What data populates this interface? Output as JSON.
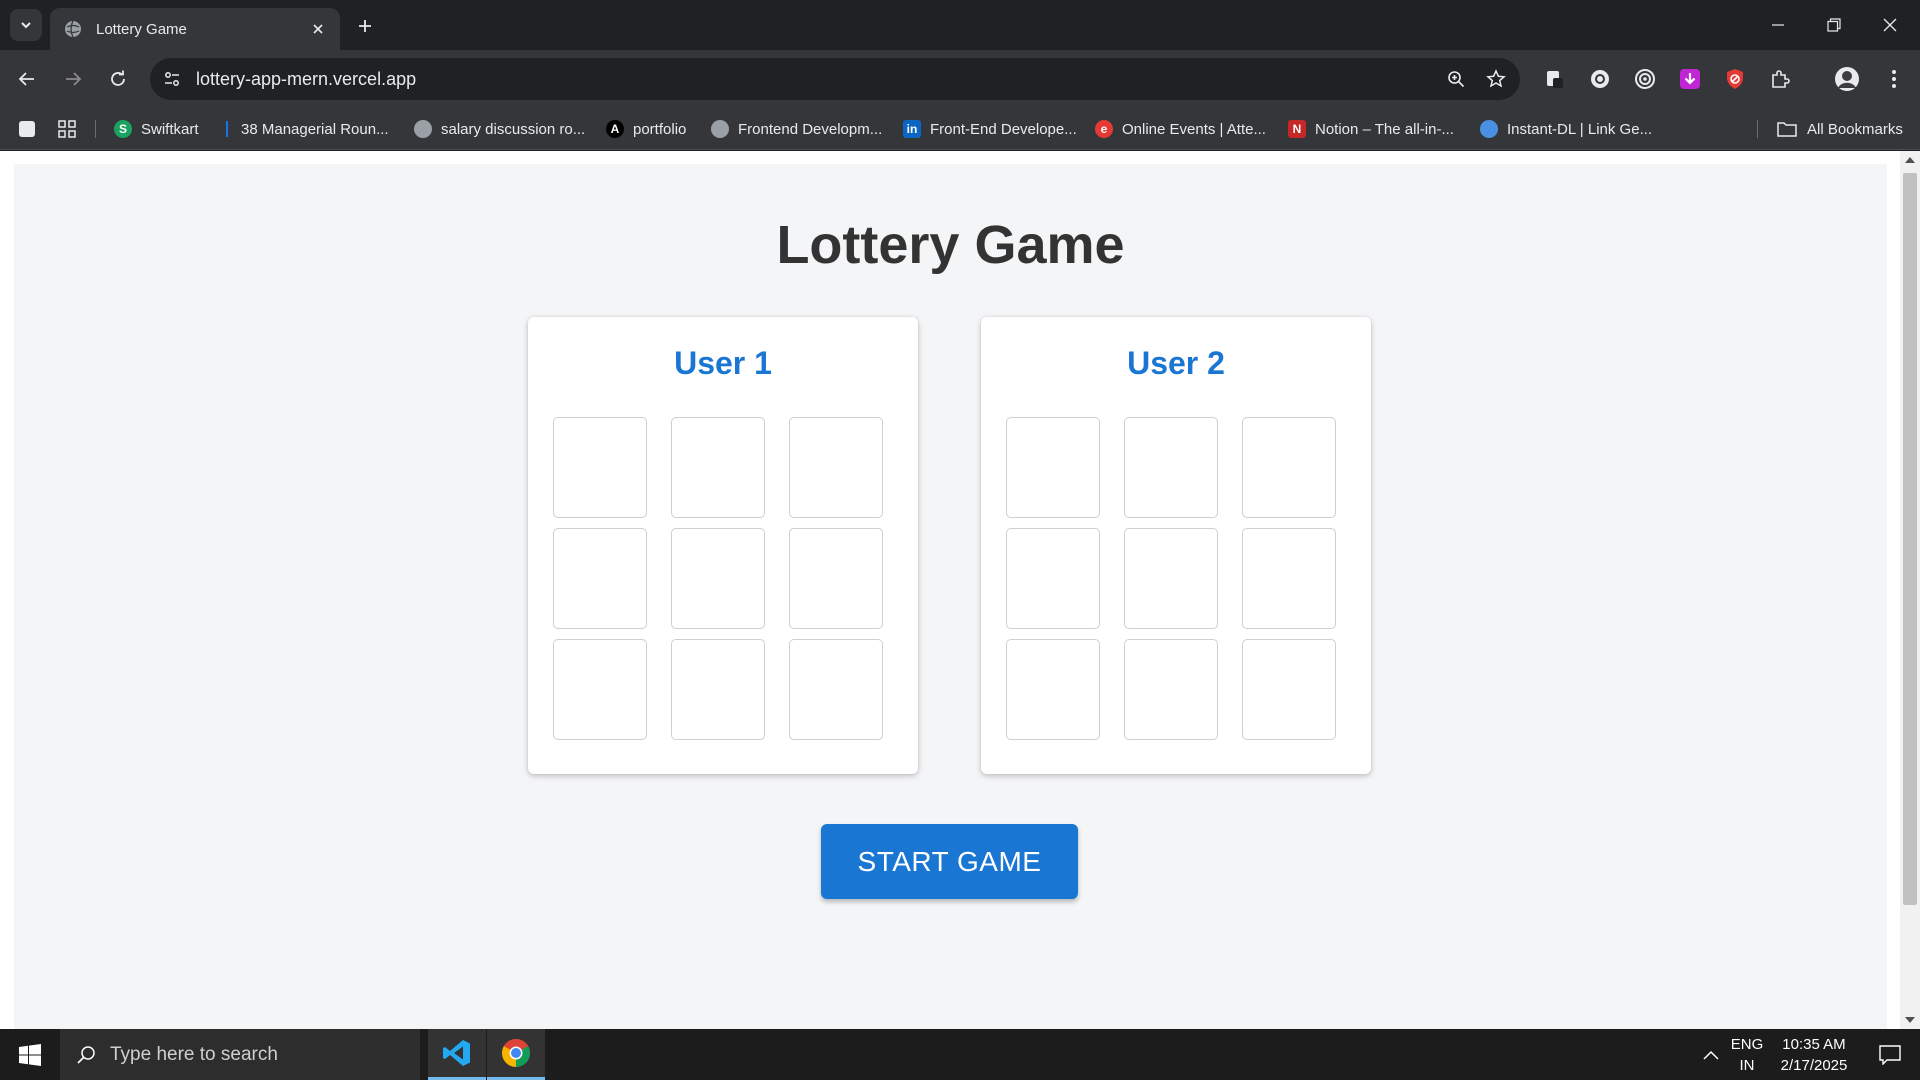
{
  "browser": {
    "tab": {
      "title": "Lottery Game"
    },
    "address": {
      "url": "lottery-app-mern.vercel.app"
    },
    "bookmarks": [
      {
        "label": "Swiftkart",
        "icon": "swiftkart-icon",
        "color": "#1aa260"
      },
      {
        "label": "38 Managerial Roun...",
        "icon": "bookmark-icon",
        "color": "#1a73e8"
      },
      {
        "label": "salary discussion ro...",
        "icon": "globe-icon",
        "color": "#9aa0a6"
      },
      {
        "label": "portfolio",
        "icon": "portfolio-icon",
        "color": "#000000"
      },
      {
        "label": "Frontend Developm...",
        "icon": "globe-icon",
        "color": "#9aa0a6"
      },
      {
        "label": "Front-End Develope...",
        "icon": "linkedin-icon",
        "color": "#0a66c2"
      },
      {
        "label": "Online Events | Atte...",
        "icon": "events-icon",
        "color": "#e53935"
      },
      {
        "label": "Notion – The all-in-...",
        "icon": "notion-icon",
        "color": "#c62828"
      },
      {
        "label": "Instant-DL | Link Ge...",
        "icon": "cloud-icon",
        "color": "#4a90e2"
      }
    ],
    "all_bookmarks_label": "All Bookmarks"
  },
  "page": {
    "title": "Lottery Game",
    "users": [
      {
        "name": "User 1",
        "cells": [
          "",
          "",
          "",
          "",
          "",
          "",
          "",
          "",
          ""
        ]
      },
      {
        "name": "User 2",
        "cells": [
          "",
          "",
          "",
          "",
          "",
          "",
          "",
          "",
          ""
        ]
      }
    ],
    "start_button_label": "START GAME",
    "colors": {
      "accent": "#1976d2",
      "title": "#333333",
      "background": "#f4f5f7"
    }
  },
  "taskbar": {
    "search_placeholder": "Type here to search",
    "lang_line1": "ENG",
    "lang_line2": "IN",
    "time": "10:35 AM",
    "date": "2/17/2025"
  }
}
